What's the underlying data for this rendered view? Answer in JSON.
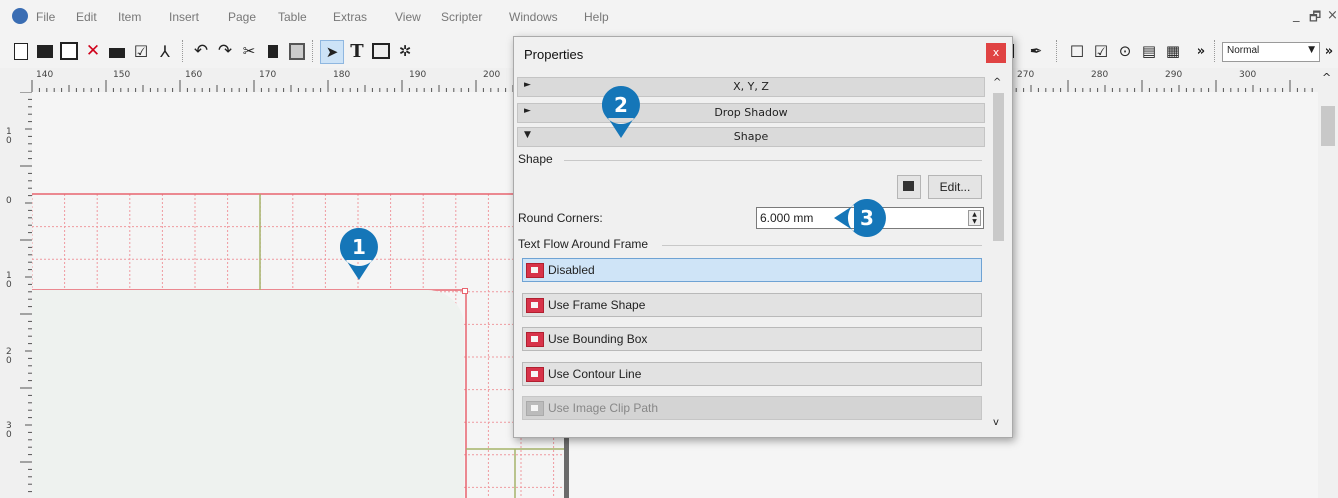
{
  "menubar": {
    "items": [
      "File",
      "Edit",
      "Item",
      "Insert",
      "Page",
      "Table",
      "Extras",
      "View",
      "Scripter",
      "Windows",
      "Help"
    ],
    "window_controls": [
      "_",
      "🗗",
      "×"
    ]
  },
  "toolbar": {
    "view_mode": "Normal",
    "overflow": "»"
  },
  "ruler": {
    "horizontal_labels": [
      "140",
      "150",
      "160",
      "170",
      "180",
      "190",
      "200",
      "270",
      "280",
      "290",
      "300"
    ],
    "vertical_labels": [
      "1\n0",
      "0",
      "1\n0",
      "2\n0",
      "3\n0"
    ]
  },
  "properties": {
    "title": "Properties",
    "close": "x",
    "sections": {
      "xyz": "X, Y, Z",
      "drop_shadow": "Drop Shadow",
      "shape": "Shape"
    },
    "shape_group_label": "Shape",
    "edit_button": "Edit...",
    "round_corners_label": "Round Corners:",
    "round_corners_value": "6.000 mm",
    "text_flow_label": "Text Flow Around Frame",
    "text_flow_options": [
      "Disabled",
      "Use Frame Shape",
      "Use Bounding Box",
      "Use Contour Line",
      "Use Image Clip Path"
    ],
    "selected_option": "Disabled"
  },
  "callouts": [
    "1",
    "2",
    "3"
  ],
  "colors": {
    "callout": "#1576b8",
    "close_button": "#e04343",
    "frame_outline": "#e8646f",
    "selected_option_bg": "#cfe4f7"
  }
}
